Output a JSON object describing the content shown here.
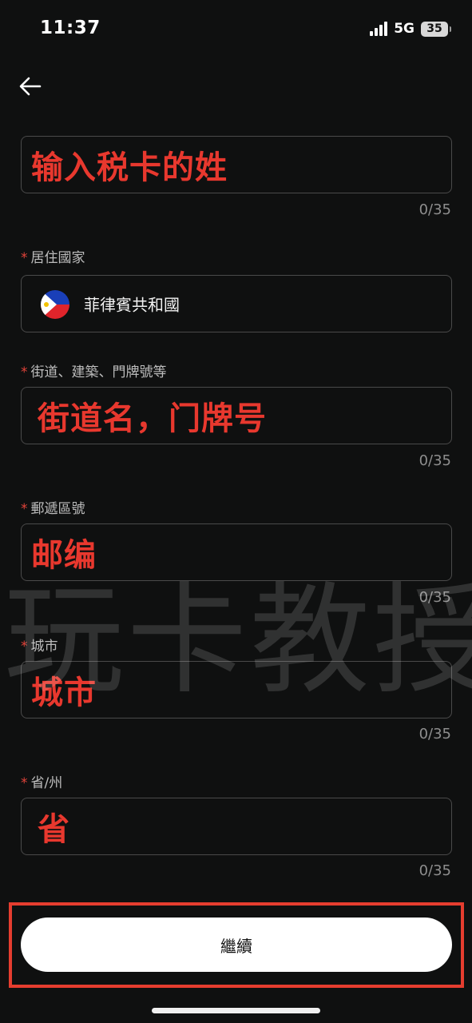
{
  "status_bar": {
    "time": "11:37",
    "network": "5G",
    "battery": "35"
  },
  "form": {
    "surname": {
      "placeholder": "输入税卡的姓",
      "counter": "0/35"
    },
    "country": {
      "label": "居住國家",
      "value": "菲律賓共和國",
      "flag_icon": "philippines-flag-icon"
    },
    "street": {
      "label": "街道、建築、門牌號等",
      "placeholder": "街道名，门牌号",
      "counter": "0/35"
    },
    "postal": {
      "label": "郵遞區號",
      "placeholder": "邮编",
      "counter": "0/35"
    },
    "city": {
      "label": "城市",
      "placeholder": "城市",
      "counter": "0/35"
    },
    "province": {
      "label": "省/州",
      "placeholder": "省",
      "counter": "0/35"
    },
    "required_mark": "*"
  },
  "continue_label": "繼續",
  "watermark": "玩卡教授",
  "colors": {
    "background": "#0f1010",
    "annotation_red": "#e8382e",
    "field_border": "#4a4a4a",
    "button_bg": "#ffffff"
  }
}
